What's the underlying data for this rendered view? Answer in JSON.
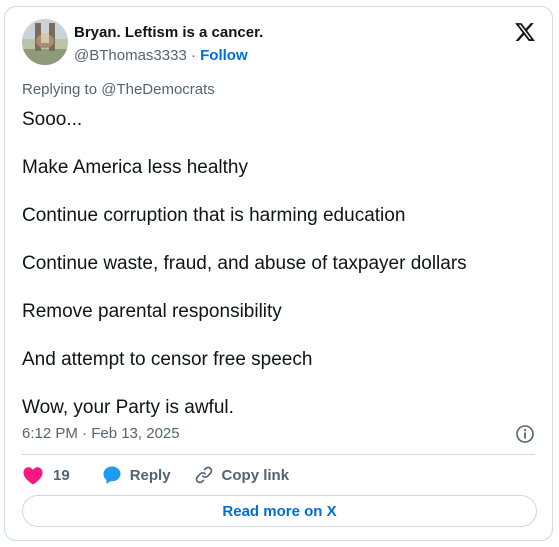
{
  "author": {
    "display_name": "Bryan. Leftism is a cancer.",
    "handle": "@BThomas3333",
    "separator": " · ",
    "follow_label": "Follow",
    "avatar_icon": "avatar-photo"
  },
  "reply_context": "Replying to @TheDemocrats",
  "body_lines": [
    "Sooo...",
    "Make America less healthy",
    "Continue corruption that is harming education",
    "Continue waste, fraud, and abuse of taxpayer dollars",
    "Remove parental responsibility",
    "And attempt to censor free speech",
    "Wow, your Party is awful."
  ],
  "timestamp": "6:12 PM · Feb 13, 2025",
  "actions": {
    "like_count": "19",
    "reply_label": "Reply",
    "copy_link_label": "Copy link"
  },
  "read_more_label": "Read more on X",
  "colors": {
    "like": "#f91880",
    "reply": "#1d9bf0",
    "link": "#006fd6",
    "muted": "#536471",
    "border": "#cfd9de"
  },
  "icons": [
    "x-logo-icon",
    "info-icon",
    "heart-icon",
    "reply-bubble-icon",
    "link-icon"
  ]
}
